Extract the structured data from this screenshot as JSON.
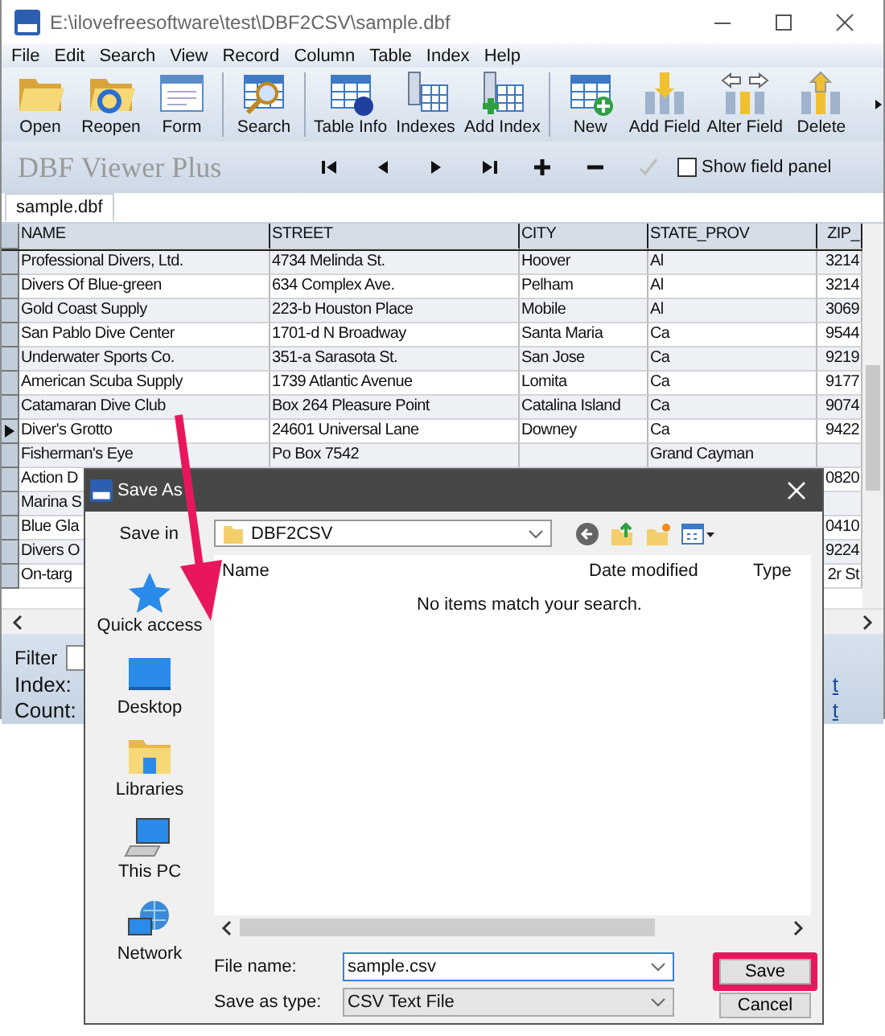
{
  "window": {
    "title": "E:\\ilovefreesoftware\\test\\DBF2CSV\\sample.dbf"
  },
  "menu": [
    "File",
    "Edit",
    "Search",
    "View",
    "Record",
    "Column",
    "Table",
    "Index",
    "Help"
  ],
  "toolbar": [
    [
      {
        "label": "Open",
        "kind": "open"
      },
      {
        "label": "Reopen",
        "kind": "reopen"
      },
      {
        "label": "Form",
        "kind": "form"
      }
    ],
    [
      {
        "label": "Search",
        "kind": "search"
      }
    ],
    [
      {
        "label": "Table Info",
        "kind": "table-info"
      },
      {
        "label": "Indexes",
        "kind": "indexes"
      },
      {
        "label": "Add Index",
        "kind": "add-index"
      }
    ],
    [
      {
        "label": "New",
        "kind": "new"
      },
      {
        "label": "Add Field",
        "kind": "add-field"
      },
      {
        "label": "Alter Field",
        "kind": "alter-field"
      },
      {
        "label": "Delete",
        "kind": "delete"
      }
    ]
  ],
  "navbar": {
    "app_name": "DBF Viewer Plus",
    "show_field_panel": {
      "label": "Show field panel",
      "checked": false
    }
  },
  "tabs": [
    {
      "label": "sample.dbf",
      "selected": true
    }
  ],
  "table": {
    "columns": [
      "NAME",
      "STREET",
      "CITY",
      "STATE_PROV",
      "ZIP_"
    ],
    "rows": [
      {
        "name": "Professional Divers, Ltd.",
        "street": "4734 Melinda St.",
        "city": "Hoover",
        "state_prov": "Al",
        "zip": "3214",
        "current": false
      },
      {
        "name": "Divers Of Blue-green",
        "street": "634 Complex Ave.",
        "city": "Pelham",
        "state_prov": "Al",
        "zip": "3214",
        "current": false
      },
      {
        "name": "Gold Coast Supply",
        "street": "223-b Houston Place",
        "city": "Mobile",
        "state_prov": "Al",
        "zip": "3069",
        "current": false
      },
      {
        "name": "San Pablo Dive Center",
        "street": "1701-d N Broadway",
        "city": "Santa Maria",
        "state_prov": "Ca",
        "zip": "9544",
        "current": false
      },
      {
        "name": "Underwater Sports Co.",
        "street": "351-a Sarasota St.",
        "city": "San Jose",
        "state_prov": "Ca",
        "zip": "9219",
        "current": false
      },
      {
        "name": "American Scuba Supply",
        "street": "1739 Atlantic Avenue",
        "city": "Lomita",
        "state_prov": "Ca",
        "zip": "9177",
        "current": false
      },
      {
        "name": "Catamaran Dive Club",
        "street": "Box 264 Pleasure Point",
        "city": "Catalina Island",
        "state_prov": "Ca",
        "zip": "9074",
        "current": false
      },
      {
        "name": "Diver's Grotto",
        "street": "24601 Universal Lane",
        "city": "Downey",
        "state_prov": "Ca",
        "zip": "9422",
        "current": true
      },
      {
        "name": "Fisherman's Eye",
        "street": "Po Box 7542",
        "state_prov": "Grand Cayman",
        "current": false
      },
      {
        "name": "Action D",
        "zip": "0820",
        "current": false
      },
      {
        "name": "Marina S",
        "current": false
      },
      {
        "name": "Blue Gla",
        "zip": "0410",
        "current": false
      },
      {
        "name": "Divers O",
        "zip": "9224",
        "current": false
      },
      {
        "name": "On-targ",
        "zip": "2r St",
        "current": false
      }
    ]
  },
  "filter_panel": {
    "filter_label": "Filter",
    "index_label": "Index:",
    "count_label": "Count:",
    "links": [
      "t",
      "t"
    ]
  },
  "dialog": {
    "title": "Save As",
    "save_in_label": "Save in",
    "save_in_value": "DBF2CSV",
    "places": [
      {
        "label": "Quick access",
        "kind": "star"
      },
      {
        "label": "Desktop",
        "kind": "desktop"
      },
      {
        "label": "Libraries",
        "kind": "libraries"
      },
      {
        "label": "This PC",
        "kind": "pc"
      },
      {
        "label": "Network",
        "kind": "network"
      }
    ],
    "columns": [
      "Name",
      "Date modified",
      "Type"
    ],
    "empty_message": "No items match your search.",
    "file_name_label": "File name:",
    "file_name_value": "sample.csv",
    "type_label": "Save as type:",
    "type_value": "CSV Text File",
    "buttons": [
      {
        "label": "Save",
        "highlighted": true
      },
      {
        "label": "Cancel",
        "highlighted": false
      }
    ]
  }
}
